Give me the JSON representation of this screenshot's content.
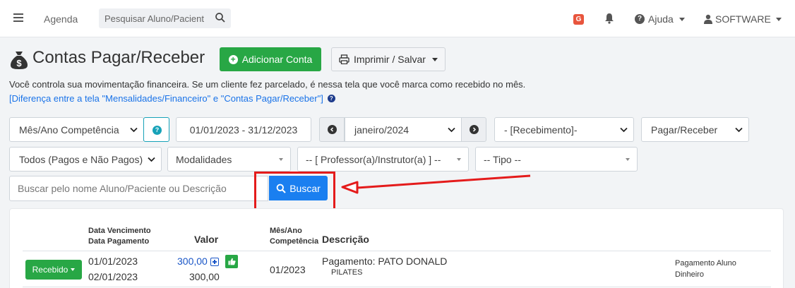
{
  "nav": {
    "agenda": "Agenda",
    "search_placeholder": "Pesquisar Aluno/Pacient",
    "g_badge": "G",
    "help": "Ajuda",
    "user": "SOFTWARE"
  },
  "header": {
    "title": "Contas Pagar/Receber",
    "add_button": "Adicionar Conta",
    "print_button": "Imprimir / Salvar",
    "description": "Você controla sua movimentação financeira. Se um cliente fez parcelado, é nessa tela que você marca como recebido no mês.",
    "difference_link": "[Diferença entre a tela \"Mensalidades/Financeiro\" e \"Contas Pagar/Receber\"]"
  },
  "filters": {
    "period_type": "Mês/Ano Competência",
    "date_range": "01/01/2023 - 31/12/2023",
    "month": "janeiro/2024",
    "receipt": "- [Recebimento]-",
    "pagar_receber": "Pagar/Receber",
    "status": "Todos (Pagos e Não Pagos)",
    "modalidades": "Modalidades",
    "professor": "-- [ Professor(a)/Instrutor(a) ] --",
    "tipo": "-- Tipo --",
    "search_placeholder": "Buscar pelo nome Aluno/Paciente ou Descrição",
    "search_button": "Buscar"
  },
  "table": {
    "headers": {
      "dates_line1": "Data Vencimento",
      "dates_line2": "Data Pagamento",
      "valor": "Valor",
      "competencia_line1": "Mês/Ano",
      "competencia_line2": "Competência",
      "descricao": "Descrição"
    },
    "rows": [
      {
        "status": "Recebido",
        "vencimento": "01/01/2023",
        "pagamento": "02/01/2023",
        "valor": "300,00",
        "valor_pago": "300,00",
        "competencia": "01/2023",
        "descricao": "Pagamento: PATO DONALD",
        "modalidade": "PILATES",
        "tipo_line1": "Pagamento Aluno",
        "tipo_line2": "Dinheiro"
      }
    ]
  },
  "colors": {
    "success": "#28a745",
    "primary": "#1a7ff0",
    "annotation": "#e41b1b"
  }
}
